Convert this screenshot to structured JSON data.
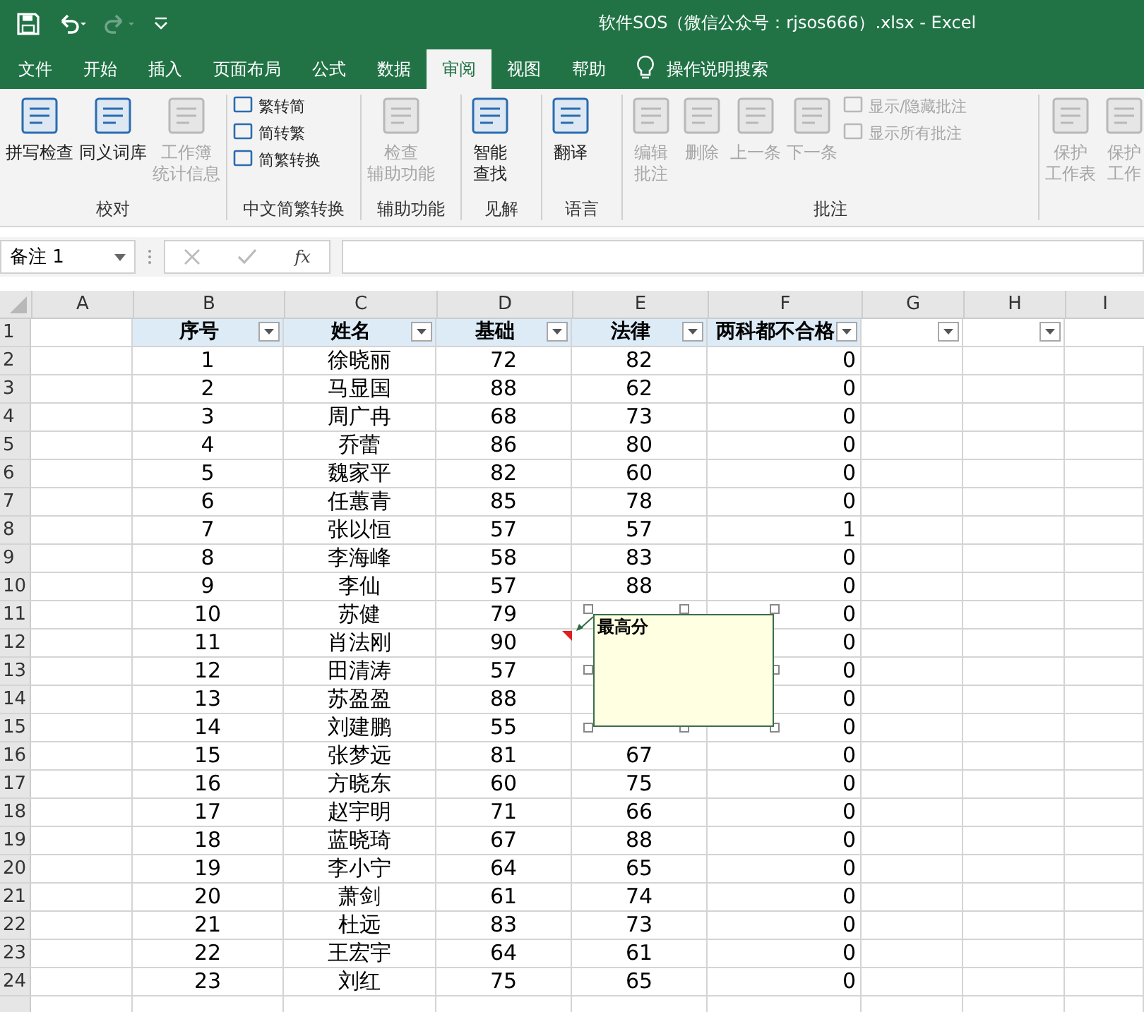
{
  "window": {
    "title": "软件SOS（微信公众号：rjsos666）.xlsx  -  Excel"
  },
  "tabs": [
    {
      "label": "文件",
      "selected": false
    },
    {
      "label": "开始",
      "selected": false
    },
    {
      "label": "插入",
      "selected": false
    },
    {
      "label": "页面布局",
      "selected": false
    },
    {
      "label": "公式",
      "selected": false
    },
    {
      "label": "数据",
      "selected": false
    },
    {
      "label": "审阅",
      "selected": true
    },
    {
      "label": "视图",
      "selected": false
    },
    {
      "label": "帮助",
      "selected": false
    }
  ],
  "tell_me": "操作说明搜索",
  "ribbon_groups": [
    {
      "label": "校对",
      "buttons": [
        {
          "kind": "large",
          "lines": [
            "拼写检查"
          ],
          "disabled": false
        },
        {
          "kind": "large",
          "lines": [
            "同义词库"
          ],
          "disabled": false
        },
        {
          "kind": "large",
          "lines": [
            "工作簿",
            "统计信息"
          ],
          "disabled": true
        }
      ]
    },
    {
      "label": "中文简繁转换",
      "buttons": [
        {
          "kind": "small",
          "lines": [
            "繁转简"
          ],
          "disabled": false
        },
        {
          "kind": "small",
          "lines": [
            "简转繁"
          ],
          "disabled": false
        },
        {
          "kind": "small",
          "lines": [
            "简繁转换"
          ],
          "disabled": false
        }
      ]
    },
    {
      "label": "辅助功能",
      "buttons": [
        {
          "kind": "large",
          "lines": [
            "检查",
            "辅助功能"
          ],
          "disabled": true
        }
      ]
    },
    {
      "label": "见解",
      "buttons": [
        {
          "kind": "large",
          "lines": [
            "智能",
            "查找"
          ],
          "disabled": false
        }
      ]
    },
    {
      "label": "语言",
      "buttons": [
        {
          "kind": "large",
          "lines": [
            "翻译"
          ],
          "disabled": false
        }
      ]
    },
    {
      "label": "批注",
      "buttons": [
        {
          "kind": "large",
          "lines": [
            "编辑",
            "批注"
          ],
          "disabled": true
        },
        {
          "kind": "large",
          "lines": [
            "删除"
          ],
          "disabled": true
        },
        {
          "kind": "large",
          "lines": [
            "上一条"
          ],
          "disabled": true
        },
        {
          "kind": "large",
          "lines": [
            "下一条"
          ],
          "disabled": true
        },
        {
          "kind": "small",
          "lines": [
            "显示/隐藏批注"
          ],
          "disabled": true
        },
        {
          "kind": "small",
          "lines": [
            "显示所有批注"
          ],
          "disabled": true
        }
      ]
    },
    {
      "buttons": [
        {
          "kind": "large",
          "lines": [
            "保护",
            "工作表"
          ],
          "disabled": true
        },
        {
          "kind": "large",
          "lines": [
            "保护",
            "工作"
          ],
          "disabled": true
        }
      ]
    }
  ],
  "name_box": "备注 1",
  "fx": "fx",
  "columns": [
    "A",
    "B",
    "C",
    "D",
    "E",
    "F",
    "G",
    "H",
    "I"
  ],
  "headers": [
    {
      "text": "序号",
      "filter": true
    },
    {
      "text": "姓名",
      "filter": true
    },
    {
      "text": "基础",
      "filter": true
    },
    {
      "text": "法律",
      "filter": true
    },
    {
      "text": "两科都不合格",
      "filter": true
    },
    {
      "filter": true
    },
    {
      "filter": true
    }
  ],
  "rows": [
    {
      "n": "2",
      "no": "1",
      "name": "徐晓丽",
      "d": "72",
      "e": "82",
      "f": "0"
    },
    {
      "n": "3",
      "no": "2",
      "name": "马显国",
      "d": "88",
      "e": "62",
      "f": "0"
    },
    {
      "n": "4",
      "no": "3",
      "name": "周广冉",
      "d": "68",
      "e": "73",
      "f": "0"
    },
    {
      "n": "5",
      "no": "4",
      "name": "乔蕾",
      "d": "86",
      "e": "80",
      "f": "0"
    },
    {
      "n": "6",
      "no": "5",
      "name": "魏家平",
      "d": "82",
      "e": "60",
      "f": "0"
    },
    {
      "n": "7",
      "no": "6",
      "name": "任蕙青",
      "d": "85",
      "e": "78",
      "f": "0"
    },
    {
      "n": "8",
      "no": "7",
      "name": "张以恒",
      "d": "57",
      "e": "57",
      "f": "1"
    },
    {
      "n": "9",
      "no": "8",
      "name": "李海峰",
      "d": "58",
      "e": "83",
      "f": "0"
    },
    {
      "n": "10",
      "no": "9",
      "name": "李仙",
      "d": "57",
      "e": "88",
      "f": "0"
    },
    {
      "n": "11",
      "no": "10",
      "name": "苏健",
      "d": "79",
      "f": "0"
    },
    {
      "n": "12",
      "no": "11",
      "name": "肖法刚",
      "d": "90",
      "f": "0"
    },
    {
      "n": "13",
      "no": "12",
      "name": "田清涛",
      "d": "57",
      "f": "0"
    },
    {
      "n": "14",
      "no": "13",
      "name": "苏盈盈",
      "d": "88",
      "f": "0"
    },
    {
      "n": "15",
      "no": "14",
      "name": "刘建鹏",
      "d": "55",
      "f": "0"
    },
    {
      "n": "16",
      "no": "15",
      "name": "张梦远",
      "d": "81",
      "e": "67",
      "f": "0"
    },
    {
      "n": "17",
      "no": "16",
      "name": "方晓东",
      "d": "60",
      "e": "75",
      "f": "0"
    },
    {
      "n": "18",
      "no": "17",
      "name": "赵宇明",
      "d": "71",
      "e": "66",
      "f": "0"
    },
    {
      "n": "19",
      "no": "18",
      "name": "蓝晓琦",
      "d": "67",
      "e": "88",
      "f": "0"
    },
    {
      "n": "20",
      "no": "19",
      "name": "李小宁",
      "d": "64",
      "e": "65",
      "f": "0"
    },
    {
      "n": "21",
      "no": "20",
      "name": "萧剑",
      "d": "61",
      "e": "74",
      "f": "0"
    },
    {
      "n": "22",
      "no": "21",
      "name": "杜远",
      "d": "83",
      "e": "73",
      "f": "0"
    },
    {
      "n": "23",
      "no": "22",
      "name": "王宏宇",
      "d": "64",
      "e": "61",
      "f": "0"
    },
    {
      "n": "24",
      "no": "23",
      "name": "刘红",
      "d": "75",
      "e": "65",
      "f": "0"
    },
    {}
  ],
  "first_row": "1",
  "comment": {
    "text": "最高分"
  }
}
